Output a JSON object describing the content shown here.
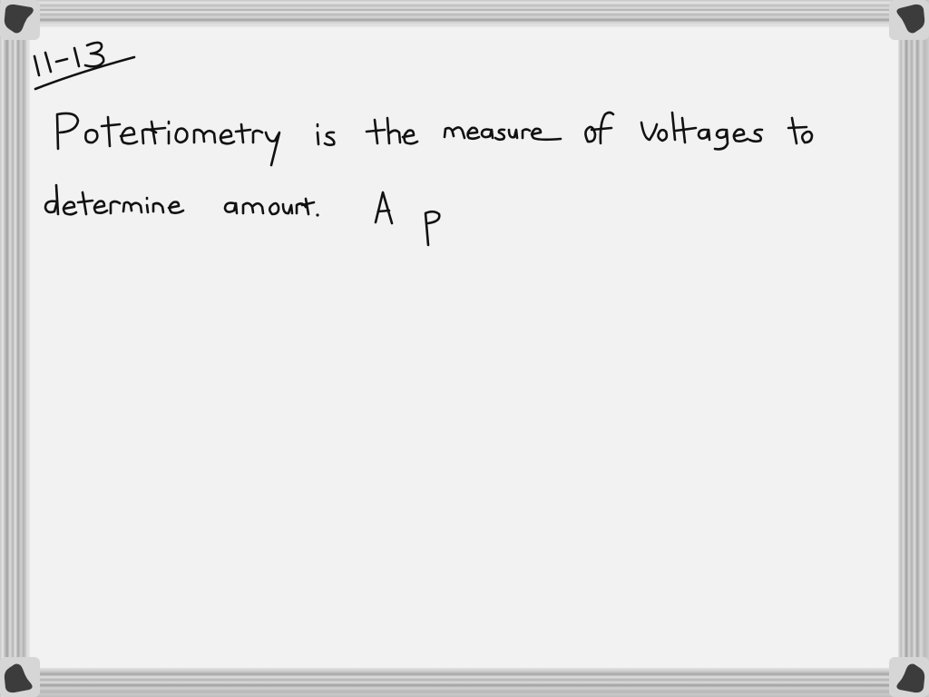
{
  "whiteboard": {
    "background_color": "#f2f2f2",
    "ink_color": "#111111",
    "frame_color": "#c8c8c8",
    "corner_cap_color": "#3c3c3c",
    "heading": "11-13",
    "lines": [
      "Potentiometry is the measure of voltages to",
      "determine amount. A p"
    ]
  }
}
